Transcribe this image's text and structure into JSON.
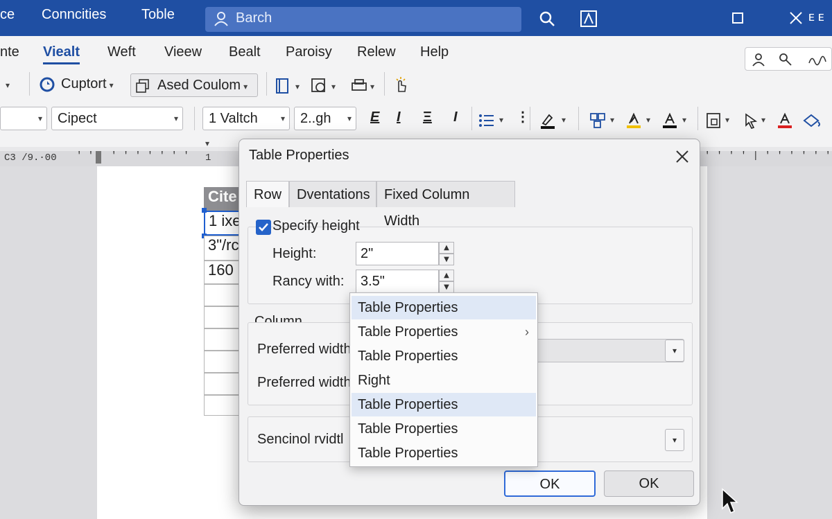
{
  "titlebar": {
    "menus": [
      "ce",
      "Conncities",
      "Toble"
    ],
    "search_placeholder": "Barch"
  },
  "ribbon": {
    "tabs": [
      "nte",
      "Viealt",
      "Weft",
      "Vieew",
      "Bealt",
      "Paroisy",
      "Relew",
      "Help"
    ],
    "active_tab": "Viealt",
    "row1": {
      "cuptort_label": "Cuptort",
      "ased_label": "Ased Coulom"
    },
    "row2": {
      "font_name": "Cipect",
      "font_style": "1 Valtch",
      "font_size": "2..gh"
    }
  },
  "ruler": {
    "left_text": "C3 /9.·00",
    "mid_text": "1"
  },
  "document": {
    "table": {
      "header": "Cite",
      "cells": [
        "1 ixe",
        "3\"/rc",
        "160"
      ]
    }
  },
  "dialog": {
    "title": "Table Properties",
    "tabs": [
      "Row",
      "Dventations",
      "Fixed Column Width"
    ],
    "active_tab": "Row",
    "row_section": {
      "specify_height_label": "Specify height",
      "specify_height_checked": true,
      "height_label": "Height:",
      "height_value": "2\"",
      "rancy_label": "Rancy with:",
      "rancy_value": "3.5\""
    },
    "column_section": {
      "title": "Column",
      "preferred_width_1": "Preferred width",
      "preferred_width_2": "Preferred width"
    },
    "sencinol_label": "Sencinol rvidtl",
    "buttons": [
      "OK",
      "OK"
    ]
  },
  "context_menu": {
    "items": [
      {
        "label": "Table Properties",
        "highlighted": true,
        "submenu": false
      },
      {
        "label": "Table Properties",
        "highlighted": false,
        "submenu": true
      },
      {
        "label": "Table Properties",
        "highlighted": false,
        "submenu": false
      },
      {
        "label": "Right",
        "highlighted": false,
        "submenu": false
      },
      {
        "label": "Table Properties",
        "highlighted": true,
        "submenu": false
      },
      {
        "label": "Table Properties",
        "highlighted": false,
        "submenu": false
      },
      {
        "label": "Table Properties",
        "highlighted": false,
        "submenu": false
      }
    ]
  },
  "colors": {
    "title_bar": "#1f4fa3",
    "accent": "#2563c9",
    "menu_highlight": "#dfe8f6"
  }
}
